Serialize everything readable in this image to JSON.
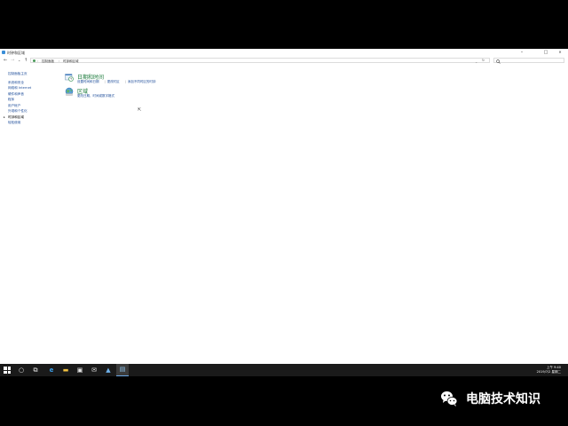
{
  "window": {
    "title": "时钟和区域",
    "controls": {
      "minimize": "–",
      "maximize": "□",
      "close": "✕"
    }
  },
  "address": {
    "back": "←",
    "forward": "→",
    "recent": "⌄",
    "up": "↑",
    "breadcrumbs": [
      "控制面板",
      "时钟和区域"
    ],
    "refresh": "↻",
    "search_placeholder": "",
    "search_icon": "search-icon"
  },
  "left_nav": {
    "items": [
      {
        "label": "控制面板主页"
      },
      {
        "label": "系统和安全"
      },
      {
        "label": "网络和 Internet"
      },
      {
        "label": "硬件和声音"
      },
      {
        "label": "程序"
      },
      {
        "label": "用户帐户"
      },
      {
        "label": "外观和个性化"
      },
      {
        "label": "时钟和区域",
        "active": true
      },
      {
        "label": "轻松使用"
      }
    ],
    "active_marker": "▸"
  },
  "categories": [
    {
      "title": "日期和时间",
      "icon": "clock-icon",
      "links": [
        "设置时间和日期",
        "更改时区",
        "添加不同时区的时钟"
      ]
    },
    {
      "title": "区域",
      "icon": "globe-icon",
      "links": [
        "更改日期、时间或数字格式"
      ]
    }
  ],
  "taskbar": {
    "buttons": [
      {
        "name": "start-button",
        "icon": "windows-logo-icon"
      },
      {
        "name": "search-button",
        "glyph": "○"
      },
      {
        "name": "task-view-button",
        "glyph": "⧉"
      },
      {
        "name": "edge-button",
        "glyph": "e"
      },
      {
        "name": "file-explorer-button",
        "glyph": "▬"
      },
      {
        "name": "store-button",
        "glyph": "▣"
      },
      {
        "name": "mail-button",
        "glyph": "✉"
      },
      {
        "name": "app-button",
        "glyph": "▲"
      },
      {
        "name": "control-panel-button",
        "glyph": "▤",
        "active": true
      }
    ],
    "clock_time": "上午 9:40",
    "clock_date": "2019/7/2 星期二"
  },
  "watermark": {
    "text": "电脑技术知识",
    "icon": "wechat-icon"
  },
  "colors": {
    "link": "#1e4d9a",
    "category_title": "#1a7a3a",
    "taskbar": "#1a1a1a",
    "letterbox": "#000000"
  }
}
